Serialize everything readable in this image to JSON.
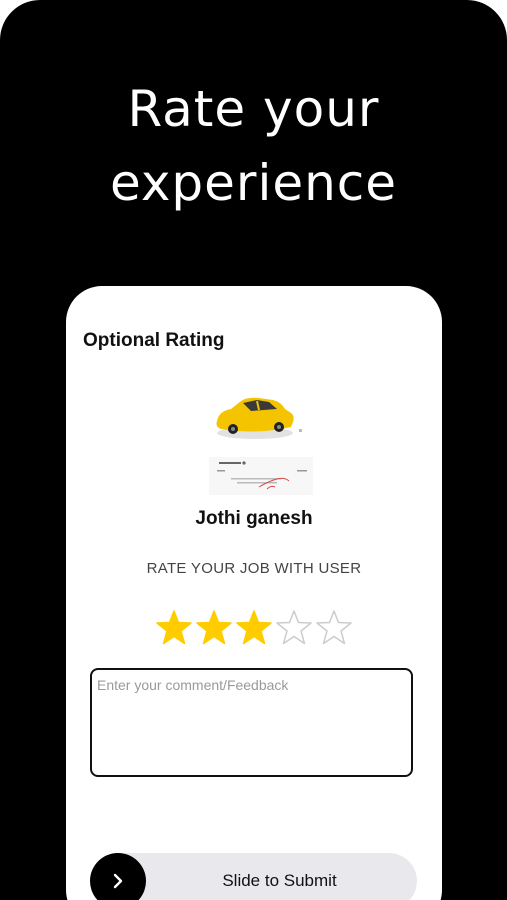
{
  "headline": {
    "line1": "Rate your",
    "line2": "experience"
  },
  "card": {
    "title": "Optional Rating",
    "user_name": "Jothi ganesh",
    "rate_label": "RATE YOUR JOB WITH USER",
    "rating": {
      "value": 3,
      "max": 5,
      "filled_color": "#FFCC00",
      "empty_color": "#CCCCCC"
    },
    "comment": {
      "value": "",
      "placeholder": "Enter your comment/Feedback"
    },
    "slider": {
      "label": "Slide to Submit",
      "icon": "chevron-right-icon"
    },
    "image": {
      "icon": "taxi-car-icon"
    }
  },
  "colors": {
    "background": "#000000",
    "card": "#FFFFFF",
    "accent": "#FFCC00",
    "slider_track": "#E9E9ED"
  }
}
